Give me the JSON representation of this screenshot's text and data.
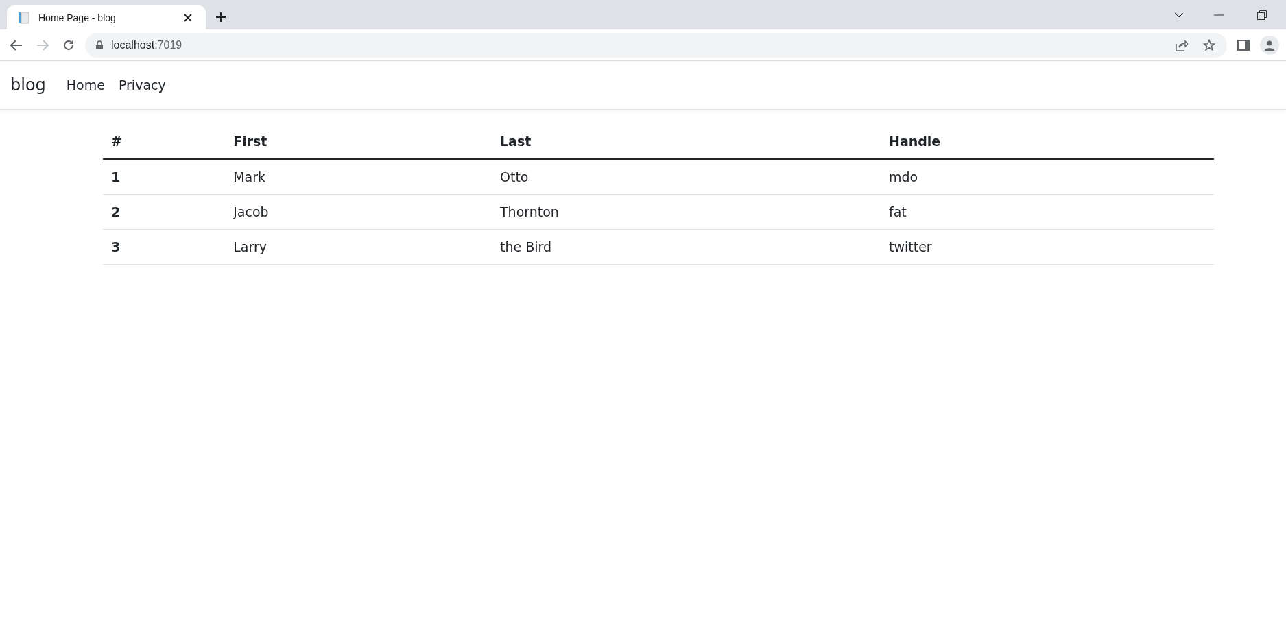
{
  "browser": {
    "tab": {
      "title": "Home Page - blog"
    },
    "address": {
      "host": "localhost",
      "port": ":7019"
    }
  },
  "navbar": {
    "brand": "blog",
    "links": [
      "Home",
      "Privacy"
    ]
  },
  "table": {
    "columns": [
      "#",
      "First",
      "Last",
      "Handle"
    ],
    "rows": [
      [
        "1",
        "Mark",
        "Otto",
        "mdo"
      ],
      [
        "2",
        "Jacob",
        "Thornton",
        "fat"
      ],
      [
        "3",
        "Larry",
        "the Bird",
        "twitter"
      ]
    ]
  }
}
